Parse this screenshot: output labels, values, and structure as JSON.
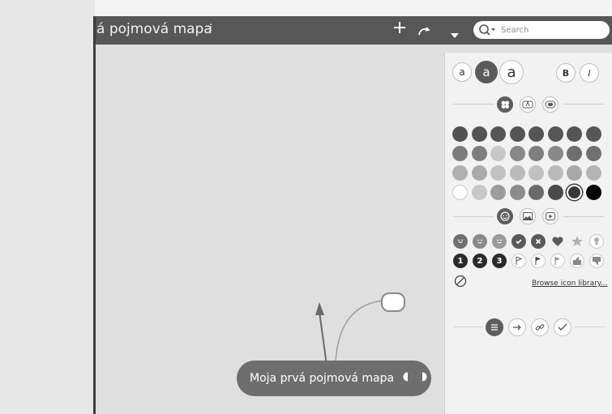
{
  "toolbar": {
    "title": "á pojmová mapa",
    "search_placeholder": "Search",
    "menu_dots": "⁝"
  },
  "map": {
    "root_label": "Moja prvá pojmová mapa",
    "child_label": ""
  },
  "panel": {
    "font_sizes": [
      "a",
      "a",
      "a"
    ],
    "bold_label": "B",
    "italic_label": "I",
    "browse_icon_library": "Browse icon library...",
    "color_tabs": [
      "colors-icon",
      "font-color-icon",
      "fill-icon"
    ],
    "icon_tabs": [
      "emoji-icon",
      "image-icon",
      "video-icon"
    ],
    "bottom_tabs": [
      "notes-icon",
      "arrow-icon",
      "link-icon",
      "check-icon"
    ],
    "palette_colors": [
      [
        "#525252",
        "#545454",
        "#565656",
        "#545454",
        "#545454",
        "#565656",
        "#545454",
        "#565656"
      ],
      [
        "#7c7c7c",
        "#7e7e7e",
        "#c8c8c8",
        "#888888",
        "#7e7e7e",
        "#888888",
        "#6e6e6e",
        "#707070"
      ],
      [
        "#b0b0b0",
        "#aaaaaa",
        "#c2c2c2",
        "#bababa",
        "#c0c0c0",
        "#bababa",
        "#a8a8a8",
        "#b4b4b4"
      ],
      [
        "#ffffff",
        "#c8c8c8",
        "#9c9c9c",
        "#8c8c8c",
        "#6a6a6a",
        "#4a4a4a",
        "#3a3a3a",
        "#050505"
      ]
    ],
    "selected_swatch_color": "#3a3a3a",
    "emoji_icons_row1": [
      "happy-icon",
      "smile-icon",
      "neutral-icon",
      "check-circle-icon",
      "x-circle-icon",
      "heart-icon",
      "star-icon",
      "bulb-icon"
    ],
    "number_icons_row2": [
      "1",
      "2",
      "3"
    ],
    "flag_icons_row2": [
      "flag-outline-icon",
      "flag-icon",
      "flag-outline-2-icon",
      "thumbs-up-icon",
      "thumbs-down-icon",
      "more-icon"
    ]
  }
}
